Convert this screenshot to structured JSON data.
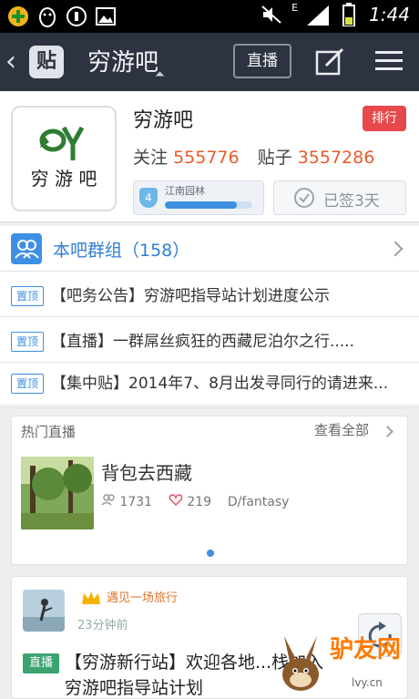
{
  "status_bar": {
    "time": "1:44",
    "network": "E",
    "icons": [
      "plus-circle-icon",
      "qq-penguin-icon",
      "usb-icon",
      "image-icon",
      "mute-icon",
      "signal-icon",
      "battery-icon"
    ]
  },
  "titlebar": {
    "logo_char": "贴",
    "title": "穷游吧",
    "live_label": "直播",
    "icons": [
      "back-arrow-icon",
      "edit-icon",
      "menu-icon"
    ]
  },
  "header": {
    "avatar_text": "穷 游 吧",
    "forum_name": "穷游吧",
    "rank_badge": "排行",
    "follow_label": "关注",
    "follow_count": "555776",
    "posts_label": "贴子",
    "posts_count": "3557286",
    "level_title": "江南园林",
    "level_num": "4",
    "level_progress": 0.82,
    "signed_label": "已签3天"
  },
  "group": {
    "label": "本吧群组（158）"
  },
  "pinned": {
    "tag": "置顶",
    "items": [
      "【吧务公告】穷游吧指导站计划进度公示",
      "【直播】一群屌丝疯狂的西藏尼泊尔之行.....",
      "【集中贴】2014年7、8月出发寻同行的请进来..."
    ]
  },
  "live_card": {
    "title": "热门直播",
    "more": "查看全部",
    "item_name": "背包去西藏",
    "views": "1731",
    "likes": "219",
    "author": "D/fantasy"
  },
  "post_card": {
    "rank_text": "遇见一场旅行",
    "time": "23分钟前",
    "tag": "直播",
    "title": "【穷游新行站】欢迎各地...栈加入穷游吧指导站计划"
  },
  "watermark": {
    "text": "驴友网",
    "url": "lvy.cn"
  },
  "colors": {
    "titlebar": "#2d3340",
    "accent_blue": "#3d8fe0",
    "count_orange": "#e85b2a",
    "rank_red": "#e7494b",
    "live_green": "#3aa36f"
  }
}
